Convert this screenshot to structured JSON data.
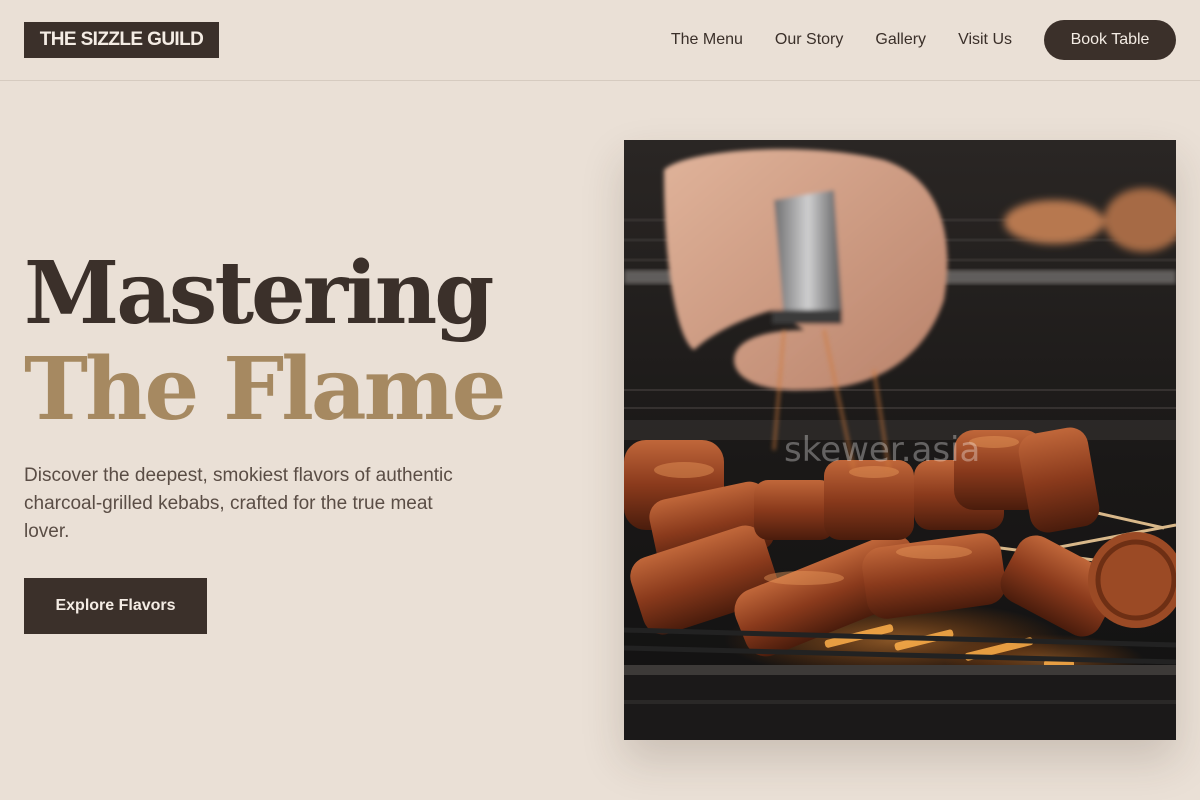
{
  "header": {
    "logo": "THE SIZZLE GUILD",
    "nav": [
      "The Menu",
      "Our Story",
      "Gallery",
      "Visit Us"
    ],
    "cta": "Book Table"
  },
  "hero": {
    "title_line1": "Mastering",
    "title_line2": "The Flame",
    "description": "Discover the deepest, smokiest flavors of authentic charcoal-grilled kebabs, crafted for the true meat lover.",
    "button": "Explore Flavors",
    "image_watermark": "skewer.asia"
  },
  "colors": {
    "background": "#eae0d6",
    "dark_brown": "#3b302a",
    "gold_accent": "#a68961",
    "body_text": "#5a4d45"
  }
}
